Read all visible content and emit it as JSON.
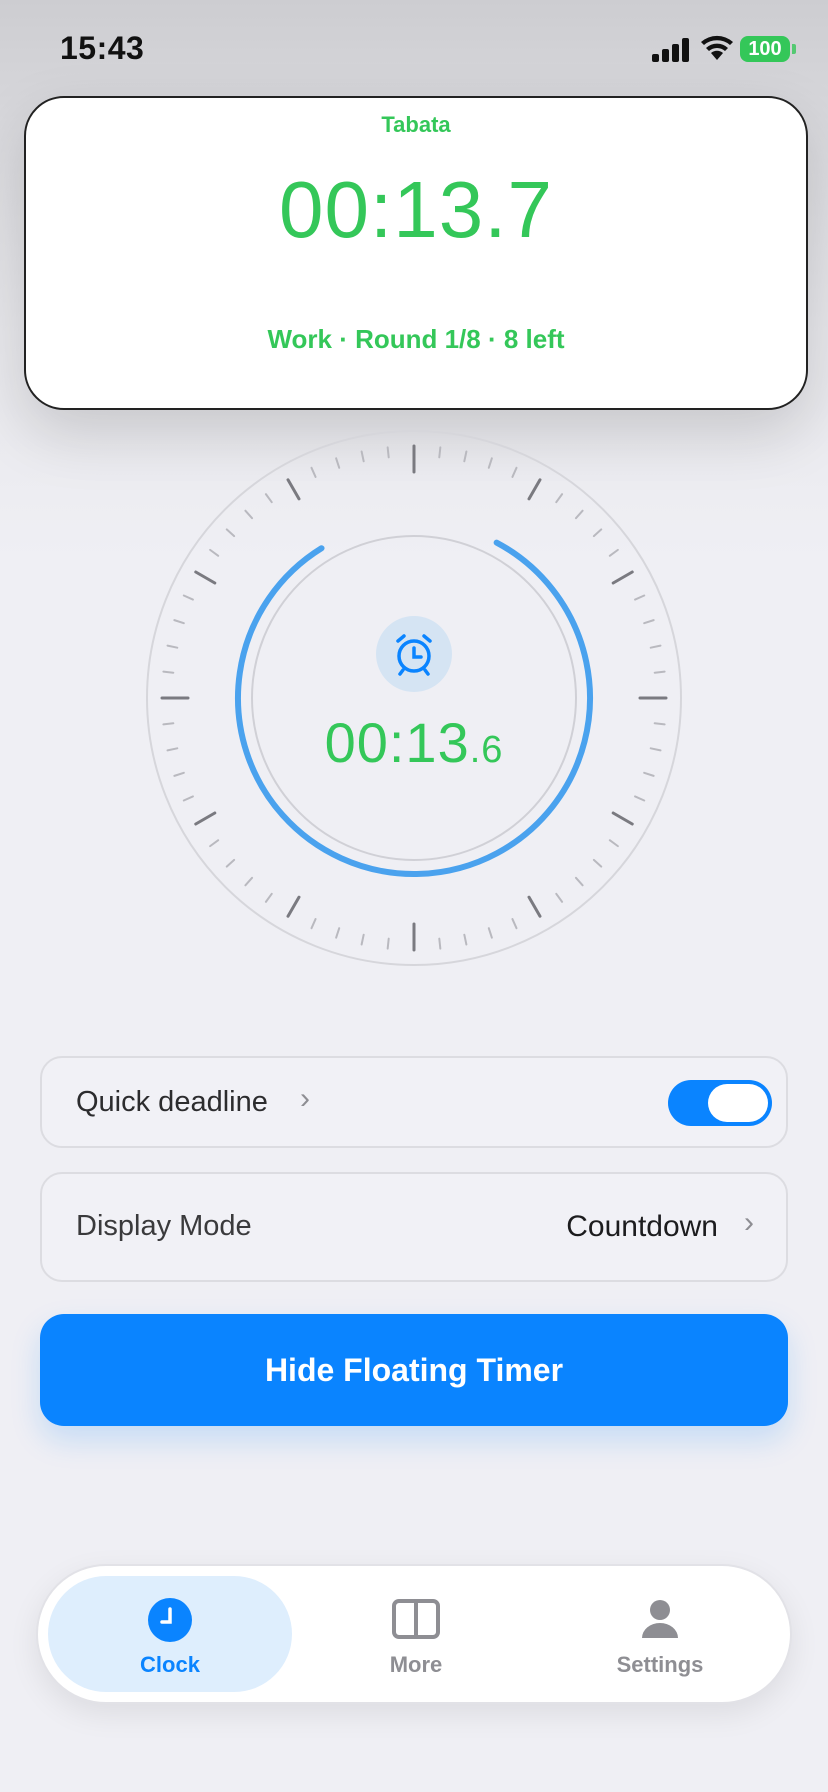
{
  "status_bar": {
    "time": "15:43",
    "battery": "100"
  },
  "floating_timer": {
    "label": "Tabata",
    "time": "00:13.7",
    "info": "Work · Round 1/8 · 8 left"
  },
  "dial": {
    "time_main": "00:13",
    "time_fraction": ".6",
    "progress": 0.86
  },
  "quick_deadline": {
    "label": "Quick deadline",
    "enabled": true
  },
  "display_mode": {
    "label": "Display Mode",
    "value": "Countdown"
  },
  "primary_button": {
    "label": "Hide Floating Timer"
  },
  "tabs": [
    {
      "label": "Clock",
      "icon": "clock-icon",
      "active": true
    },
    {
      "label": "More",
      "icon": "split-view-icon",
      "active": false
    },
    {
      "label": "Settings",
      "icon": "person-icon",
      "active": false
    }
  ],
  "colors": {
    "accent": "#0a84ff",
    "timer_green": "#34c759",
    "background": "#efeff4"
  }
}
